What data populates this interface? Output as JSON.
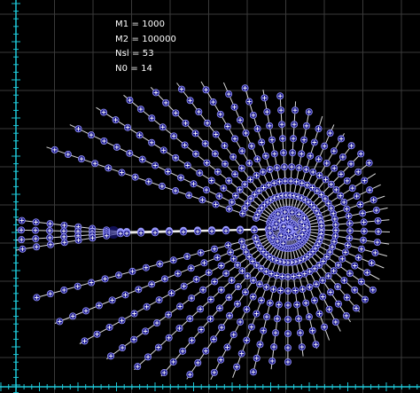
{
  "params": [
    {
      "text": "M1 = 1000"
    },
    {
      "text": "M2 = 100000"
    },
    {
      "text": "Nsl = 53"
    },
    {
      "text": "N0 = 14"
    }
  ],
  "model": {
    "M1": 1000,
    "M2": 100000,
    "Nsl": 53,
    "N0": 14
  },
  "colors": {
    "background": "#000000",
    "grid": "#3a3a3a",
    "axis": "#1ec8d8",
    "field_line": "#ffffff",
    "marker_fill": "#1c1a8e",
    "marker_edge": "#9a9aff",
    "marker_cross": "#ffffff",
    "text": "#ffffff"
  }
}
